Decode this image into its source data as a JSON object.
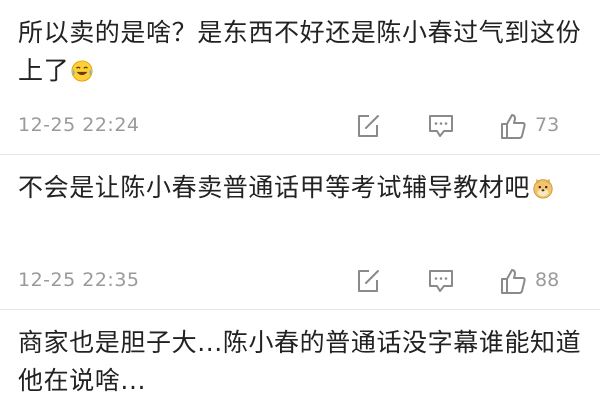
{
  "comments": [
    {
      "text": "所以卖的是啥？是东西不好还是陈小春过气到这份上了",
      "emoji": "laughing-crying-emoji",
      "timestamp": "12-25 22:24",
      "like_count": "73"
    },
    {
      "text": "不会是让陈小春卖普通话甲等考试辅导教材吧",
      "emoji": "doge-emoji",
      "timestamp": "12-25 22:35",
      "like_count": "88"
    },
    {
      "text": "商家也是胆子大...陈小春的普通话没字幕谁能知道他在说啥..."
    }
  ],
  "icons": {
    "repost": "share-icon",
    "reply": "comment-icon",
    "like": "thumbs-up-icon"
  },
  "colors": {
    "text": "#222222",
    "meta": "#9a9a9a",
    "divider": "#e6e6e6"
  }
}
